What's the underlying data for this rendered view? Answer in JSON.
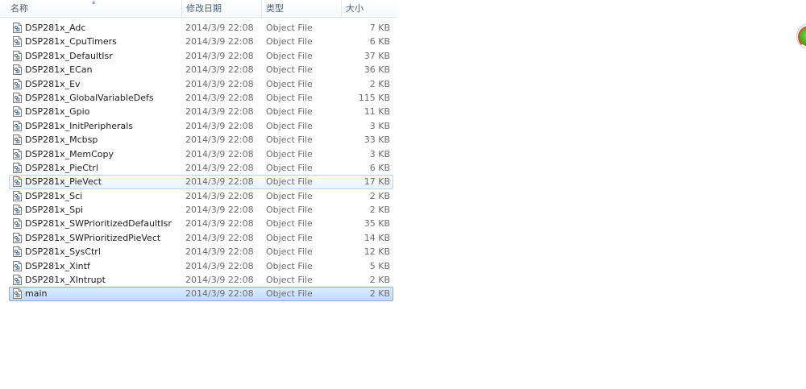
{
  "columns": {
    "name": "名称",
    "date": "修改日期",
    "type": "类型",
    "size": "大小"
  },
  "sort_indicator": "up-arrow-icon",
  "files": [
    {
      "name": "DSP281x_Adc",
      "date": "2014/3/9 22:08",
      "type": "Object File",
      "size": "7 KB",
      "icon": "object-file-icon"
    },
    {
      "name": "DSP281x_CpuTimers",
      "date": "2014/3/9 22:08",
      "type": "Object File",
      "size": "6 KB",
      "icon": "object-file-icon"
    },
    {
      "name": "DSP281x_DefaultIsr",
      "date": "2014/3/9 22:08",
      "type": "Object File",
      "size": "37 KB",
      "icon": "object-file-icon"
    },
    {
      "name": "DSP281x_ECan",
      "date": "2014/3/9 22:08",
      "type": "Object File",
      "size": "36 KB",
      "icon": "object-file-icon"
    },
    {
      "name": "DSP281x_Ev",
      "date": "2014/3/9 22:08",
      "type": "Object File",
      "size": "2 KB",
      "icon": "object-file-icon"
    },
    {
      "name": "DSP281x_GlobalVariableDefs",
      "date": "2014/3/9 22:08",
      "type": "Object File",
      "size": "115 KB",
      "icon": "object-file-icon"
    },
    {
      "name": "DSP281x_Gpio",
      "date": "2014/3/9 22:08",
      "type": "Object File",
      "size": "11 KB",
      "icon": "object-file-icon"
    },
    {
      "name": "DSP281x_InitPeripherals",
      "date": "2014/3/9 22:08",
      "type": "Object File",
      "size": "3 KB",
      "icon": "object-file-icon"
    },
    {
      "name": "DSP281x_Mcbsp",
      "date": "2014/3/9 22:08",
      "type": "Object File",
      "size": "33 KB",
      "icon": "object-file-icon"
    },
    {
      "name": "DSP281x_MemCopy",
      "date": "2014/3/9 22:08",
      "type": "Object File",
      "size": "3 KB",
      "icon": "object-file-icon"
    },
    {
      "name": "DSP281x_PieCtrl",
      "date": "2014/3/9 22:08",
      "type": "Object File",
      "size": "6 KB",
      "icon": "object-file-icon"
    },
    {
      "name": "DSP281x_PieVect",
      "date": "2014/3/9 22:08",
      "type": "Object File",
      "size": "17 KB",
      "icon": "object-file-icon",
      "state": "hover"
    },
    {
      "name": "DSP281x_Sci",
      "date": "2014/3/9 22:08",
      "type": "Object File",
      "size": "2 KB",
      "icon": "object-file-icon"
    },
    {
      "name": "DSP281x_Spi",
      "date": "2014/3/9 22:08",
      "type": "Object File",
      "size": "2 KB",
      "icon": "object-file-icon"
    },
    {
      "name": "DSP281x_SWPrioritizedDefaultIsr",
      "date": "2014/3/9 22:08",
      "type": "Object File",
      "size": "35 KB",
      "icon": "object-file-icon"
    },
    {
      "name": "DSP281x_SWPrioritizedPieVect",
      "date": "2014/3/9 22:08",
      "type": "Object File",
      "size": "14 KB",
      "icon": "object-file-icon"
    },
    {
      "name": "DSP281x_SysCtrl",
      "date": "2014/3/9 22:08",
      "type": "Object File",
      "size": "12 KB",
      "icon": "object-file-icon"
    },
    {
      "name": "DSP281x_Xintf",
      "date": "2014/3/9 22:08",
      "type": "Object File",
      "size": "5 KB",
      "icon": "object-file-icon"
    },
    {
      "name": "DSP281x_XIntrupt",
      "date": "2014/3/9 22:08",
      "type": "Object File",
      "size": "2 KB",
      "icon": "object-file-icon"
    },
    {
      "name": "main",
      "date": "2014/3/9 22:08",
      "type": "Object File",
      "size": "2 KB",
      "icon": "object-file-icon",
      "state": "selected"
    }
  ],
  "colors": {
    "hover_border": "#b8d6fb",
    "selected_border": "#84acdd",
    "header_text": "#4c607a",
    "detail_text": "#6d6d6d"
  },
  "side_widget_icon": "green-orb-icon"
}
